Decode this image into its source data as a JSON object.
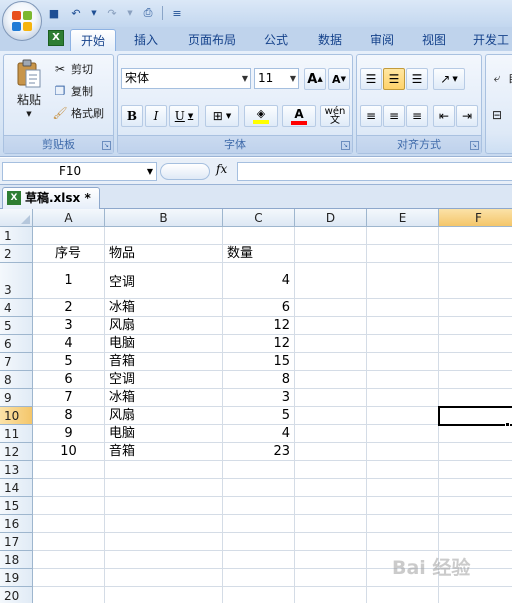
{
  "quick_access": {
    "icons": [
      "save-icon",
      "undo-icon",
      "redo-icon",
      "print-preview-icon",
      "customize-icon"
    ]
  },
  "tabs": [
    {
      "label": "开始",
      "active": true
    },
    {
      "label": "插入"
    },
    {
      "label": "页面布局"
    },
    {
      "label": "公式"
    },
    {
      "label": "数据"
    },
    {
      "label": "审阅"
    },
    {
      "label": "视图"
    },
    {
      "label": "开发工"
    }
  ],
  "ribbon": {
    "clipboard": {
      "label": "剪贴板",
      "paste": "粘贴",
      "cut": "剪切",
      "copy": "复制",
      "format_painter": "格式刷"
    },
    "font": {
      "label": "字体",
      "name": "宋体",
      "size": "11",
      "grow": "A",
      "shrink": "A",
      "bold": "B",
      "italic": "I",
      "underline": "U",
      "fill_color": "#ffff00",
      "font_color": "#ff0000",
      "phonetic": "wén\n文",
      "font_color_letter": "A"
    },
    "alignment": {
      "label": "对齐方式"
    },
    "wrap_text": "自"
  },
  "formula_bar": {
    "name_box": "F10",
    "fx": "fx",
    "formula": ""
  },
  "workbook": {
    "tab_title": "草稿.xlsx *"
  },
  "grid": {
    "columns": [
      "A",
      "B",
      "C",
      "D",
      "E",
      "F"
    ],
    "selected_column": "F",
    "selected_row": "10",
    "rows": [
      {
        "n": "1",
        "a": "",
        "b": "",
        "c": ""
      },
      {
        "n": "2",
        "a": "序号",
        "b": "物品",
        "c": "数量"
      },
      {
        "n": "3",
        "a": "1",
        "b": "空调",
        "c": "4"
      },
      {
        "n": "4",
        "a": "2",
        "b": "冰箱",
        "c": "6"
      },
      {
        "n": "5",
        "a": "3",
        "b": "风扇",
        "c": "12"
      },
      {
        "n": "6",
        "a": "4",
        "b": "电脑",
        "c": "12"
      },
      {
        "n": "7",
        "a": "5",
        "b": "音箱",
        "c": "15"
      },
      {
        "n": "8",
        "a": "6",
        "b": "空调",
        "c": "8"
      },
      {
        "n": "9",
        "a": "7",
        "b": "冰箱",
        "c": "3"
      },
      {
        "n": "10",
        "a": "8",
        "b": "风扇",
        "c": "5"
      },
      {
        "n": "11",
        "a": "9",
        "b": "电脑",
        "c": "4"
      },
      {
        "n": "12",
        "a": "10",
        "b": "音箱",
        "c": "23"
      },
      {
        "n": "13",
        "a": "",
        "b": "",
        "c": ""
      },
      {
        "n": "14",
        "a": "",
        "b": "",
        "c": ""
      },
      {
        "n": "15",
        "a": "",
        "b": "",
        "c": ""
      },
      {
        "n": "16",
        "a": "",
        "b": "",
        "c": ""
      },
      {
        "n": "17",
        "a": "",
        "b": "",
        "c": ""
      },
      {
        "n": "18",
        "a": "",
        "b": "",
        "c": ""
      },
      {
        "n": "19",
        "a": "",
        "b": "",
        "c": ""
      },
      {
        "n": "20",
        "a": "",
        "b": "",
        "c": ""
      }
    ]
  },
  "watermark": "Bai 经验"
}
